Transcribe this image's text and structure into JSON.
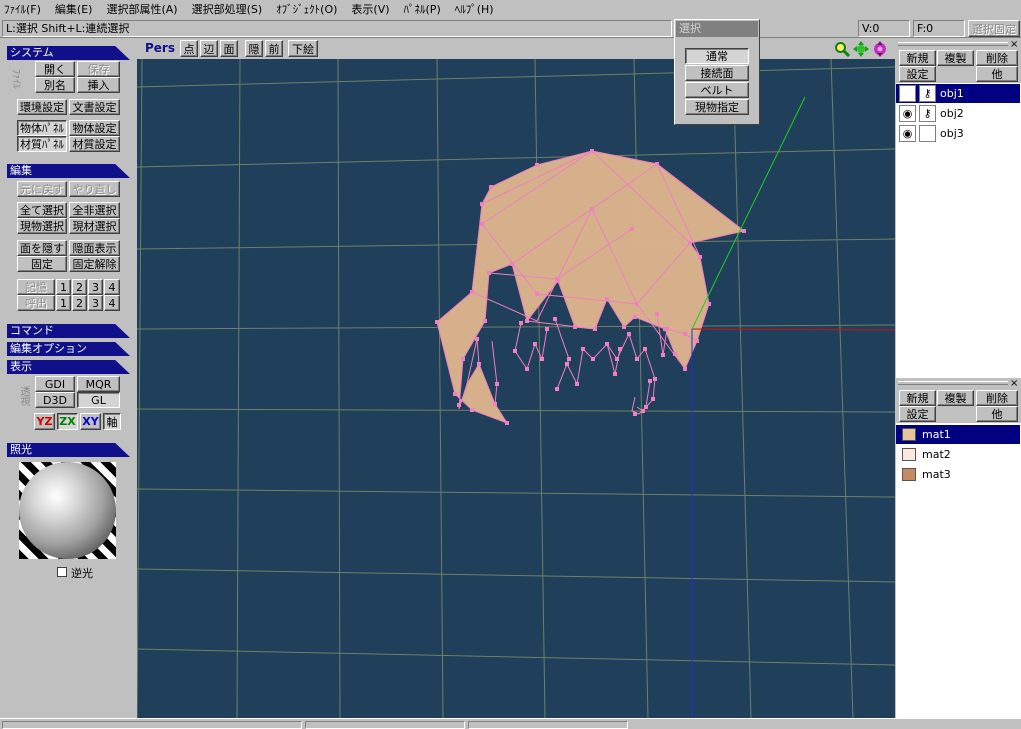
{
  "menu": [
    "ﾌｧｲﾙ(F)",
    "編集(E)",
    "選択部属性(A)",
    "選択部処理(S)",
    "ｵﾌﾞｼﾞｪｸﾄ(O)",
    "表示(V)",
    "ﾊﾟﾈﾙ(P)",
    "ﾍﾙﾌﾟ(H)"
  ],
  "status": {
    "hint": "L:選択  Shift+L:連続選択",
    "v": "V:0",
    "f": "F:0",
    "lock": "選択固定"
  },
  "view": {
    "mode": "Pers",
    "buttons": [
      "点",
      "辺",
      "面",
      "隠",
      "前",
      "下絵"
    ]
  },
  "selpanel": {
    "title": "選択",
    "items": [
      "通常",
      "接続面",
      "ベルト",
      "現物指定"
    ]
  },
  "system": {
    "title": "システム",
    "side": "ﾌｧｲﾙ",
    "open": "開く",
    "save": "保存",
    "saveas": "別名",
    "insert": "挿入",
    "env": "環境設定",
    "doc": "文書設定",
    "objpanel": "物体ﾊﾟﾈﾙ",
    "objset": "物体設定",
    "matpanel": "材質ﾊﾟﾈﾙ",
    "matset": "材質設定"
  },
  "edit": {
    "title": "編集",
    "undo": "元に戻す",
    "redo": "やり直し",
    "selall": "全て選択",
    "unselall": "全非選択",
    "selcur": "現物選択",
    "selmat": "現材選択",
    "hide": "面を隠す",
    "showhidden": "隠面表示",
    "fix": "固定",
    "unfix": "固定解除",
    "memory": "記憶",
    "recall": "呼出",
    "n1": "1",
    "n2": "2",
    "n3": "3",
    "n4": "4"
  },
  "command": {
    "title": "コマンド"
  },
  "editopt": {
    "title": "編集オプション"
  },
  "display": {
    "title": "表示",
    "side": "透視",
    "gdi": "GDI",
    "mqr": "MQR",
    "d3d": "D3D",
    "gl": "GL",
    "yz": "YZ",
    "zx": "ZX",
    "xy": "XY",
    "axis": "軸"
  },
  "light": {
    "title": "照光",
    "backlight": "逆光"
  },
  "objects": {
    "new": "新規",
    "dup": "複製",
    "del": "削除",
    "set": "設定",
    "other": "他",
    "items": [
      "obj1",
      "obj2",
      "obj3"
    ]
  },
  "materials": {
    "new": "新規",
    "dup": "複製",
    "del": "削除",
    "set": "設定",
    "other": "他",
    "items": [
      {
        "name": "mat1",
        "color": "#e8c49a"
      },
      {
        "name": "mat2",
        "color": "#fbe8dc"
      },
      {
        "name": "mat3",
        "color": "#c48a62"
      }
    ]
  },
  "colors": {
    "viewport": "#1f3f5a",
    "mesh_fill": "#deb48e",
    "mesh_edge": "#f080c0",
    "x_axis": "#d01010",
    "y_axis": "#20d020",
    "z_axis": "#2030e0"
  }
}
